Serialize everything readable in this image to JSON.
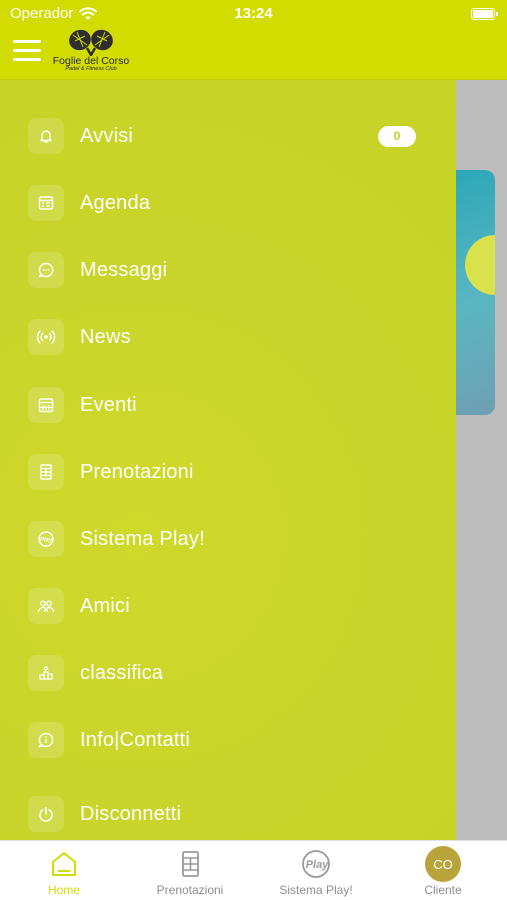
{
  "status_bar": {
    "carrier": "Operador",
    "time": "13:24"
  },
  "header": {
    "logo_name": "Foglie del Corso",
    "logo_subtitle": "Padel & Fitness Club"
  },
  "menu": {
    "items": [
      {
        "label": "Avvisi",
        "icon": "bell-icon",
        "badge": "0"
      },
      {
        "label": "Agenda",
        "icon": "agenda-icon"
      },
      {
        "label": "Messaggi",
        "icon": "chat-icon"
      },
      {
        "label": "News",
        "icon": "broadcast-icon"
      },
      {
        "label": "Eventi",
        "icon": "calendar-icon"
      },
      {
        "label": "Prenotazioni",
        "icon": "court-icon"
      },
      {
        "label": "Sistema Play!",
        "icon": "play-icon"
      },
      {
        "label": "Amici",
        "icon": "friends-icon"
      },
      {
        "label": "classifica",
        "icon": "podium-icon"
      },
      {
        "label": "Info|Contatti",
        "icon": "info-chat-icon"
      },
      {
        "label": "Disconnetti",
        "icon": "power-icon"
      }
    ]
  },
  "tabbar": {
    "tabs": [
      {
        "label": "Home",
        "icon": "home-icon",
        "active": true
      },
      {
        "label": "Prenotazioni",
        "icon": "court-icon"
      },
      {
        "label": "Sistema Play!",
        "icon": "play-icon"
      },
      {
        "label": "Cliente",
        "icon": "avatar",
        "initials": "CO"
      }
    ]
  },
  "colors": {
    "brand": "#d2dc00",
    "drawer": "#c9d52a",
    "avatar": "#b8a43a"
  }
}
